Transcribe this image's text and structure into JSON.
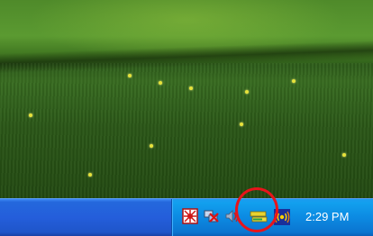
{
  "taskbar": {
    "clock": "2:29 PM"
  },
  "tray_icons": [
    {
      "name": "antivirus-icon"
    },
    {
      "name": "network-disconnected-icon"
    },
    {
      "name": "volume-icon"
    },
    {
      "name": "safely-remove-hardware-icon"
    },
    {
      "name": "wireless-network-icon"
    }
  ],
  "colors": {
    "taskbar_blue": "#245edb",
    "tray_blue": "#0c8ae2",
    "highlight_red": "#e8141b"
  }
}
